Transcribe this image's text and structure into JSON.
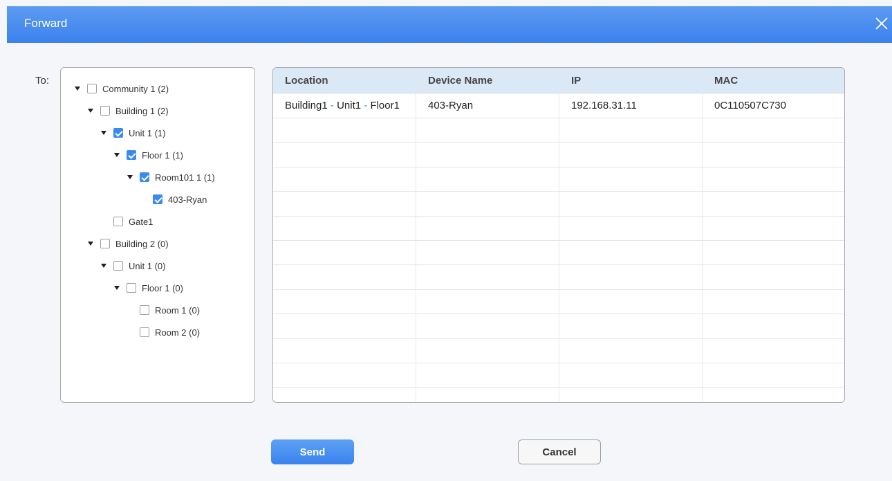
{
  "dialog": {
    "title": "Forward",
    "to_label": "To:"
  },
  "tree": [
    {
      "label": "Community 1 (2)",
      "checked": false,
      "expanded": true,
      "depth": 0
    },
    {
      "label": "Building 1 (2)",
      "checked": false,
      "expanded": true,
      "depth": 1
    },
    {
      "label": "Unit 1 (1)",
      "checked": true,
      "expanded": true,
      "depth": 2
    },
    {
      "label": "Floor 1 (1)",
      "checked": true,
      "expanded": true,
      "depth": 3
    },
    {
      "label": "Room101 1 (1)",
      "checked": true,
      "expanded": true,
      "depth": 4
    },
    {
      "label": "403-Ryan",
      "checked": true,
      "expanded": null,
      "depth": 5
    },
    {
      "label": "Gate1",
      "checked": false,
      "expanded": null,
      "depth": 2
    },
    {
      "label": "Building 2 (0)",
      "checked": false,
      "expanded": true,
      "depth": 1
    },
    {
      "label": "Unit 1 (0)",
      "checked": false,
      "expanded": true,
      "depth": 2
    },
    {
      "label": "Floor 1 (0)",
      "checked": false,
      "expanded": true,
      "depth": 3
    },
    {
      "label": "Room 1 (0)",
      "checked": false,
      "expanded": null,
      "depth": 4
    },
    {
      "label": "Room 2 (0)",
      "checked": false,
      "expanded": null,
      "depth": 4
    }
  ],
  "table": {
    "columns": [
      "Location",
      "Device Name",
      "IP",
      "MAC"
    ],
    "rows": [
      {
        "location": [
          "Building1",
          "Unit1",
          "Floor1"
        ],
        "device_name": "403-Ryan",
        "ip": "192.168.31.11",
        "mac": "0C110507C730"
      }
    ]
  },
  "buttons": {
    "send": "Send",
    "cancel": "Cancel"
  },
  "colors": {
    "accent": "#3a8bf0",
    "header_bg": "#dbe8f6",
    "titlebar": "#4a8ef0"
  },
  "icons": {
    "close": "close-icon",
    "expand": "caret-down-icon",
    "checkbox": "checkbox-icon"
  }
}
